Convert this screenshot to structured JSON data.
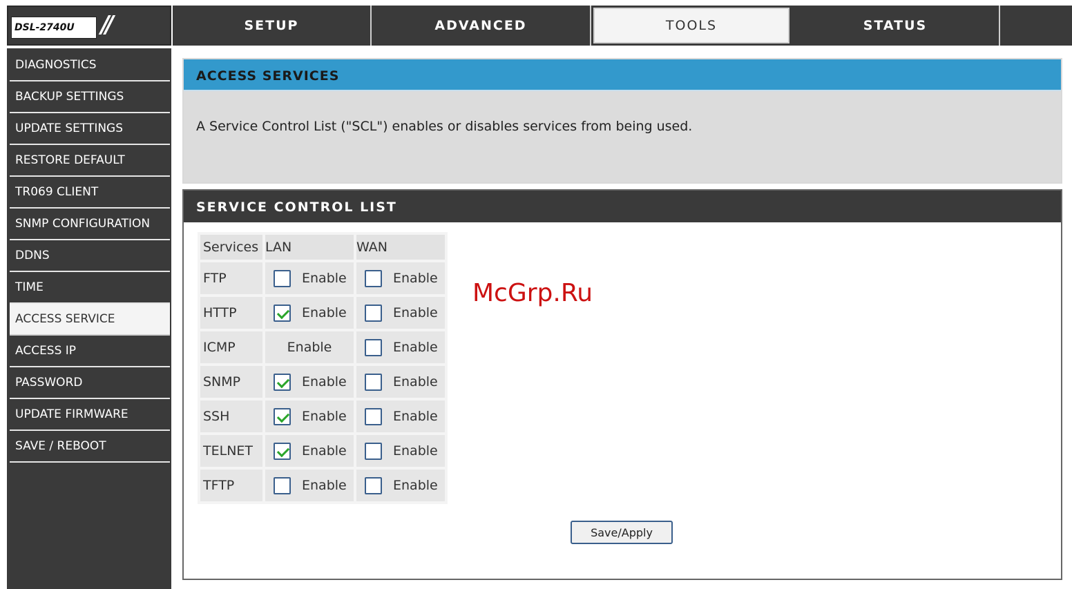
{
  "header": {
    "model": "DSL-2740U",
    "tabs": [
      "SETUP",
      "ADVANCED",
      "TOOLS",
      "STATUS",
      ""
    ],
    "active_tab": "TOOLS"
  },
  "sidebar": {
    "items": [
      "DIAGNOSTICS",
      "BACKUP SETTINGS",
      "UPDATE SETTINGS",
      "RESTORE DEFAULT",
      "TR069 CLIENT",
      "SNMP CONFIGURATION",
      "DDNS",
      "TIME",
      "ACCESS SERVICE",
      "ACCESS IP",
      "PASSWORD",
      "UPDATE FIRMWARE",
      "SAVE / REBOOT"
    ],
    "active_item": "ACCESS SERVICE"
  },
  "access_services": {
    "title": "ACCESS SERVICES",
    "description": "A Service Control List (\"SCL\") enables or disables services from being used."
  },
  "scl": {
    "title": "SERVICE CONTROL LIST",
    "headers": {
      "services": "Services",
      "lan": "LAN",
      "wan": "WAN"
    },
    "enable_label": "Enable",
    "rows": [
      {
        "service": "FTP",
        "lan_checkbox": true,
        "lan_checked": false,
        "wan_checked": false
      },
      {
        "service": "HTTP",
        "lan_checkbox": true,
        "lan_checked": true,
        "wan_checked": false
      },
      {
        "service": "ICMP",
        "lan_checkbox": false,
        "lan_checked": false,
        "wan_checked": false
      },
      {
        "service": "SNMP",
        "lan_checkbox": true,
        "lan_checked": true,
        "wan_checked": false
      },
      {
        "service": "SSH",
        "lan_checkbox": true,
        "lan_checked": true,
        "wan_checked": false
      },
      {
        "service": "TELNET",
        "lan_checkbox": true,
        "lan_checked": true,
        "wan_checked": false
      },
      {
        "service": "TFTP",
        "lan_checkbox": true,
        "lan_checked": false,
        "wan_checked": false
      }
    ],
    "save_label": "Save/Apply"
  },
  "watermark": "McGrp.Ru",
  "colors": {
    "nav_bg": "#3a3a3a",
    "title_blue": "#3399cc",
    "check_green": "#2aa52a"
  }
}
